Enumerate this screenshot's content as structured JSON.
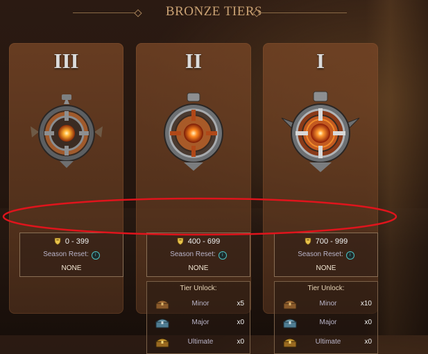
{
  "title": "BRONZE TIERS",
  "tiers": [
    {
      "numeral": "III",
      "range": "0 - 399",
      "season_reset_label": "Season Reset:",
      "season_reset_value": "NONE"
    },
    {
      "numeral": "II",
      "range": "400 - 699",
      "season_reset_label": "Season Reset:",
      "season_reset_value": "NONE",
      "unlock": {
        "title": "Tier Unlock:",
        "rewards": [
          {
            "name": "Minor",
            "count": "x5"
          },
          {
            "name": "Major",
            "count": "x0"
          },
          {
            "name": "Ultimate",
            "count": "x0"
          }
        ]
      }
    },
    {
      "numeral": "I",
      "range": "700 - 999",
      "season_reset_label": "Season Reset:",
      "season_reset_value": "NONE",
      "unlock": {
        "title": "Tier Unlock:",
        "rewards": [
          {
            "name": "Minor",
            "count": "x10"
          },
          {
            "name": "Major",
            "count": "x0"
          },
          {
            "name": "Ultimate",
            "count": "x0"
          }
        ]
      }
    }
  ],
  "info_icon_glyph": "i",
  "icons": {
    "trophy": "shield-trophy-icon",
    "info": "info-icon",
    "minor_chest": "wooden-chest-icon",
    "major_chest": "blue-chest-icon",
    "ultimate_chest": "gold-chest-icon"
  },
  "colors": {
    "title": "#c9a173",
    "card": "#7a4a28",
    "annotation": "#e0141c",
    "info_accent": "#4ec0c0"
  }
}
